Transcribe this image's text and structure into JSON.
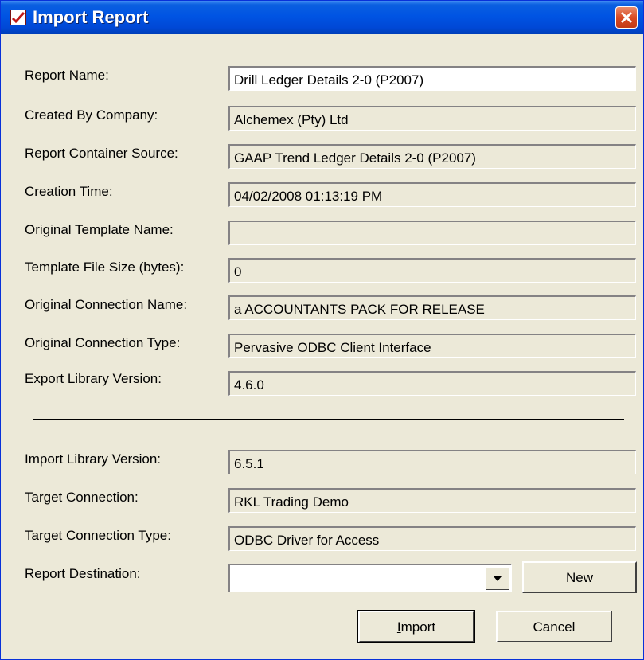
{
  "window": {
    "title": "Import Report"
  },
  "fields": [
    {
      "label": "Report Name:",
      "value": "Drill Ledger Details 2-0 (P2007)",
      "editable": true
    },
    {
      "label": "Created By Company:",
      "value": "Alchemex (Pty) Ltd",
      "editable": false
    },
    {
      "label": "Report Container Source:",
      "value": "GAAP Trend Ledger Details 2-0 (P2007)",
      "editable": false
    },
    {
      "label": "Creation Time:",
      "value": "04/02/2008 01:13:19 PM",
      "editable": false
    },
    {
      "label": "Original Template Name:",
      "value": "",
      "editable": false
    },
    {
      "label": "Template File Size (bytes):",
      "value": "0",
      "editable": false
    },
    {
      "label": "Original Connection Name:",
      "value": "a ACCOUNTANTS PACK FOR RELEASE",
      "editable": false
    },
    {
      "label": "Original Connection Type:",
      "value": "Pervasive ODBC Client Interface",
      "editable": false
    },
    {
      "label": "Export Library Version:",
      "value": "4.6.0",
      "editable": false
    }
  ],
  "import_fields": [
    {
      "label": "Import Library Version:",
      "value": "6.5.1"
    },
    {
      "label": "Target Connection:",
      "value": "RKL Trading Demo"
    },
    {
      "label": "Target Connection Type:",
      "value": "ODBC Driver for Access"
    }
  ],
  "destination": {
    "label": "Report Destination:",
    "value": ""
  },
  "buttons": {
    "new": "New",
    "import_prefix": "I",
    "import_rest": "mport",
    "cancel": "Cancel"
  },
  "icons": {
    "app": "checkmark-document-icon",
    "close": "close-x-icon",
    "dropdown": "triangle-down-icon"
  },
  "colors": {
    "titlebar": "#0054e3",
    "dialog_bg": "#ece9d8",
    "close": "#d84a23"
  }
}
